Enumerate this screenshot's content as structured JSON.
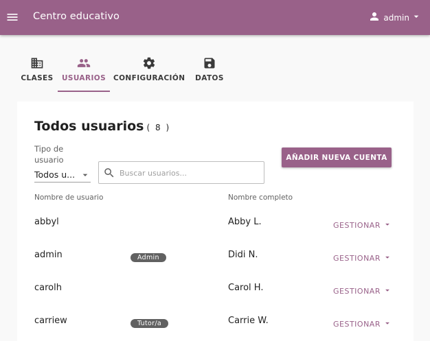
{
  "appbar": {
    "title": "Centro educativo",
    "user": "admin",
    "menu_icon": "menu-icon",
    "user_icon": "person-icon"
  },
  "tabs": [
    {
      "label": "CLASES",
      "icon": "domain-icon",
      "active": false
    },
    {
      "label": "USUARIOS",
      "icon": "people-icon",
      "active": true
    },
    {
      "label": "CONFIGURACIÓN",
      "icon": "gear-icon",
      "active": false
    },
    {
      "label": "DATOS",
      "icon": "save-icon",
      "active": false
    }
  ],
  "users_page": {
    "title": "Todos usuarios",
    "count": "( 8 )",
    "filter_label": "Tipo de usuario",
    "filter_value": "Todos u...",
    "search_placeholder": "Buscar usuarios...",
    "add_button": "AÑADIR NUEVA CUENTA",
    "col_username": "Nombre de usuario",
    "col_fullname": "Nombre completo",
    "rows": [
      {
        "username": "abbyl",
        "badge": "",
        "fullname": "Abby L.",
        "action": "GESTIONAR"
      },
      {
        "username": "admin",
        "badge": "Admin",
        "fullname": "Didi N.",
        "action": "GESTIONAR"
      },
      {
        "username": "carolh",
        "badge": "",
        "fullname": "Carol H.",
        "action": "GESTIONAR"
      },
      {
        "username": "carriew",
        "badge": "Tutor/a",
        "fullname": "Carrie W.",
        "action": "GESTIONAR"
      }
    ]
  },
  "colors": {
    "primary": "#996189",
    "background": "#f9f9f9",
    "badge": "#616161"
  }
}
